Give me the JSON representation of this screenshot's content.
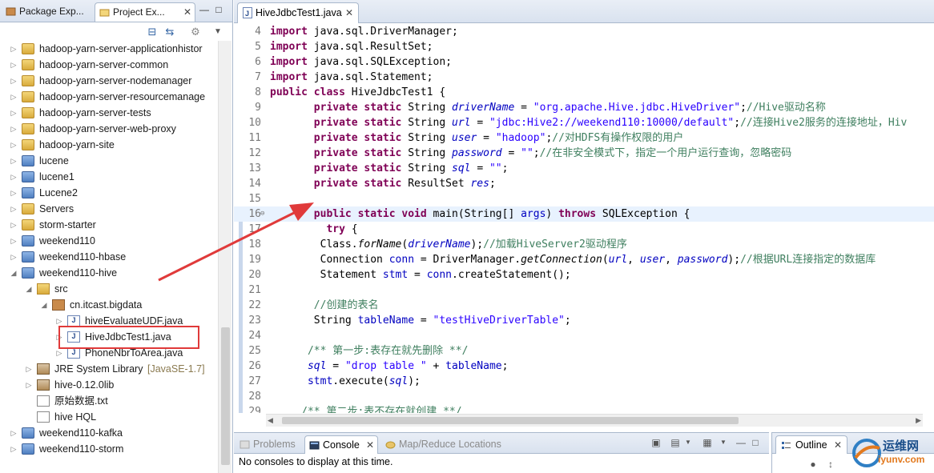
{
  "left_panel": {
    "tabs": [
      {
        "label": "Package Exp..."
      },
      {
        "label": "Project Ex..."
      }
    ],
    "tree": [
      {
        "label": "hadoop-yarn-server-applicationhistor",
        "icon": "folder-icon",
        "depth": 0,
        "expander": "collapsed"
      },
      {
        "label": "hadoop-yarn-server-common",
        "icon": "folder-icon",
        "depth": 0,
        "expander": "collapsed"
      },
      {
        "label": "hadoop-yarn-server-nodemanager",
        "icon": "folder-icon",
        "depth": 0,
        "expander": "collapsed"
      },
      {
        "label": "hadoop-yarn-server-resourcemanage",
        "icon": "folder-icon",
        "depth": 0,
        "expander": "collapsed"
      },
      {
        "label": "hadoop-yarn-server-tests",
        "icon": "folder-icon",
        "depth": 0,
        "expander": "collapsed"
      },
      {
        "label": "hadoop-yarn-server-web-proxy",
        "icon": "folder-icon",
        "depth": 0,
        "expander": "collapsed"
      },
      {
        "label": "hadoop-yarn-site",
        "icon": "folder-icon",
        "depth": 0,
        "expander": "collapsed"
      },
      {
        "label": "lucene",
        "icon": "project-icon",
        "depth": 0,
        "expander": "collapsed"
      },
      {
        "label": "lucene1",
        "icon": "project-icon",
        "depth": 0,
        "expander": "collapsed"
      },
      {
        "label": "Lucene2",
        "icon": "project-icon",
        "depth": 0,
        "expander": "collapsed"
      },
      {
        "label": "Servers",
        "icon": "folder-icon",
        "depth": 0,
        "expander": "collapsed"
      },
      {
        "label": "storm-starter",
        "icon": "folder-icon",
        "depth": 0,
        "expander": "collapsed"
      },
      {
        "label": "weekend110",
        "icon": "project-icon",
        "depth": 0,
        "expander": "collapsed"
      },
      {
        "label": "weekend110-hbase",
        "icon": "project-icon",
        "depth": 0,
        "expander": "collapsed"
      },
      {
        "label": "weekend110-hive",
        "icon": "project-icon",
        "depth": 0,
        "expander": "expanded"
      },
      {
        "label": "src",
        "icon": "source-folder-icon",
        "depth": 1,
        "expander": "expanded"
      },
      {
        "label": "cn.itcast.bigdata",
        "icon": "package-icon",
        "depth": 2,
        "expander": "expanded"
      },
      {
        "label": "hiveEvaluateUDF.java",
        "icon": "java-file-icon",
        "depth": 3,
        "expander": "collapsed"
      },
      {
        "label": "HiveJdbcTest1.java",
        "icon": "java-file-icon",
        "depth": 3,
        "expander": "collapsed"
      },
      {
        "label": "PhoneNbrToArea.java",
        "icon": "java-file-icon",
        "depth": 3,
        "expander": "collapsed"
      },
      {
        "label": "JRE System Library",
        "extra": "[JavaSE-1.7]",
        "icon": "library-icon",
        "depth": 1,
        "expander": "collapsed"
      },
      {
        "label": "hive-0.12.0lib",
        "icon": "library-icon",
        "depth": 1,
        "expander": "collapsed"
      },
      {
        "label": "原始数据.txt",
        "icon": "text-file-icon",
        "depth": 1,
        "expander": "none"
      },
      {
        "label": "hive HQL",
        "icon": "text-file-icon",
        "depth": 1,
        "expander": "none"
      },
      {
        "label": "weekend110-kafka",
        "icon": "project-icon",
        "depth": 0,
        "expander": "collapsed"
      },
      {
        "label": "weekend110-storm",
        "icon": "project-icon",
        "depth": 0,
        "expander": "collapsed"
      }
    ]
  },
  "editor": {
    "tab_label": "HiveJdbcTest1.java",
    "current_line": 16,
    "lines": [
      {
        "n": "4",
        "tokens": [
          [
            "kw",
            "import"
          ],
          [
            "t",
            " java.sql.DriverManager;"
          ]
        ]
      },
      {
        "n": "5",
        "tokens": [
          [
            "kw",
            "import"
          ],
          [
            "t",
            " java.sql.ResultSet;"
          ]
        ]
      },
      {
        "n": "6",
        "tokens": [
          [
            "kw",
            "import"
          ],
          [
            "t",
            " java.sql.SQLException;"
          ]
        ]
      },
      {
        "n": "7",
        "tokens": [
          [
            "kw",
            "import"
          ],
          [
            "t",
            " java.sql.Statement;"
          ]
        ]
      },
      {
        "n": "8",
        "tokens": [
          [
            "kw",
            "public"
          ],
          [
            "t",
            " "
          ],
          [
            "kw",
            "class"
          ],
          [
            "t",
            " HiveJdbcTest1 {"
          ]
        ]
      },
      {
        "n": "9",
        "tokens": [
          [
            "t",
            "       "
          ],
          [
            "kw",
            "private"
          ],
          [
            "t",
            " "
          ],
          [
            "kw",
            "static"
          ],
          [
            "t",
            " String "
          ],
          [
            "fld",
            "driverName"
          ],
          [
            "t",
            " = "
          ],
          [
            "str",
            "\"org.apache.Hive.jdbc.HiveDriver\""
          ],
          [
            "t",
            ";"
          ],
          [
            "cmt",
            "//Hive驱动名称"
          ]
        ]
      },
      {
        "n": "10",
        "tokens": [
          [
            "t",
            "       "
          ],
          [
            "kw",
            "private"
          ],
          [
            "t",
            " "
          ],
          [
            "kw",
            "static"
          ],
          [
            "t",
            " String "
          ],
          [
            "fld",
            "url"
          ],
          [
            "t",
            " = "
          ],
          [
            "str",
            "\"jdbc:Hive2://weekend110:10000/default\""
          ],
          [
            "t",
            ";"
          ],
          [
            "cmt",
            "//连接Hive2服务的连接地址，Hiv"
          ]
        ]
      },
      {
        "n": "11",
        "tokens": [
          [
            "t",
            "       "
          ],
          [
            "kw",
            "private"
          ],
          [
            "t",
            " "
          ],
          [
            "kw",
            "static"
          ],
          [
            "t",
            " String "
          ],
          [
            "fld",
            "user"
          ],
          [
            "t",
            " = "
          ],
          [
            "str",
            "\"hadoop\""
          ],
          [
            "t",
            ";"
          ],
          [
            "cmt",
            "//对HDFS有操作权限的用户"
          ]
        ]
      },
      {
        "n": "12",
        "tokens": [
          [
            "t",
            "       "
          ],
          [
            "kw",
            "private"
          ],
          [
            "t",
            " "
          ],
          [
            "kw",
            "static"
          ],
          [
            "t",
            " String "
          ],
          [
            "fld",
            "password"
          ],
          [
            "t",
            " = "
          ],
          [
            "str",
            "\"\""
          ],
          [
            "t",
            ";"
          ],
          [
            "cmt",
            "//在非安全模式下，指定一个用户运行查询，忽略密码"
          ]
        ]
      },
      {
        "n": "13",
        "tokens": [
          [
            "t",
            "       "
          ],
          [
            "kw",
            "private"
          ],
          [
            "t",
            " "
          ],
          [
            "kw",
            "static"
          ],
          [
            "t",
            " String "
          ],
          [
            "fld",
            "sql"
          ],
          [
            "t",
            " = "
          ],
          [
            "str",
            "\"\""
          ],
          [
            "t",
            ";"
          ]
        ]
      },
      {
        "n": "14",
        "tokens": [
          [
            "t",
            "       "
          ],
          [
            "kw",
            "private"
          ],
          [
            "t",
            " "
          ],
          [
            "kw",
            "static"
          ],
          [
            "t",
            " ResultSet "
          ],
          [
            "fld",
            "res"
          ],
          [
            "t",
            ";"
          ]
        ]
      },
      {
        "n": "15",
        "tokens": []
      },
      {
        "n": "16",
        "tokens": [
          [
            "t",
            "       "
          ],
          [
            "kw",
            "public"
          ],
          [
            "t",
            " "
          ],
          [
            "kw",
            "static"
          ],
          [
            "t",
            " "
          ],
          [
            "kw",
            "void"
          ],
          [
            "t",
            " main(String[] "
          ],
          [
            "ivar",
            "args"
          ],
          [
            "t",
            ") "
          ],
          [
            "kw",
            "throws"
          ],
          [
            "t",
            " SQLException {"
          ]
        ]
      },
      {
        "n": "17",
        "tokens": [
          [
            "t",
            "         "
          ],
          [
            "kw",
            "try"
          ],
          [
            "t",
            " {"
          ]
        ]
      },
      {
        "n": "18",
        "tokens": [
          [
            "t",
            "        Class."
          ],
          [
            "mth",
            "forName"
          ],
          [
            "t",
            "("
          ],
          [
            "fld",
            "driverName"
          ],
          [
            "t",
            ");"
          ],
          [
            "cmt",
            "//加载HiveServer2驱动程序"
          ]
        ]
      },
      {
        "n": "19",
        "tokens": [
          [
            "t",
            "        Connection "
          ],
          [
            "ivar",
            "conn"
          ],
          [
            "t",
            " = DriverManager."
          ],
          [
            "mth",
            "getConnection"
          ],
          [
            "t",
            "("
          ],
          [
            "fld",
            "url"
          ],
          [
            "t",
            ", "
          ],
          [
            "fld",
            "user"
          ],
          [
            "t",
            ", "
          ],
          [
            "fld",
            "password"
          ],
          [
            "t",
            ");"
          ],
          [
            "cmt",
            "//根据URL连接指定的数据库"
          ]
        ]
      },
      {
        "n": "20",
        "tokens": [
          [
            "t",
            "        Statement "
          ],
          [
            "ivar",
            "stmt"
          ],
          [
            "t",
            " = "
          ],
          [
            "ivar",
            "conn"
          ],
          [
            "t",
            ".createStatement();"
          ]
        ]
      },
      {
        "n": "21",
        "tokens": []
      },
      {
        "n": "22",
        "tokens": [
          [
            "t",
            "       "
          ],
          [
            "cmt",
            "//创建的表名"
          ]
        ]
      },
      {
        "n": "23",
        "tokens": [
          [
            "t",
            "       String "
          ],
          [
            "ivar",
            "tableName"
          ],
          [
            "t",
            " = "
          ],
          [
            "str",
            "\"testHiveDriverTable\""
          ],
          [
            "t",
            ";"
          ]
        ]
      },
      {
        "n": "24",
        "tokens": []
      },
      {
        "n": "25",
        "tokens": [
          [
            "t",
            "      "
          ],
          [
            "cmt",
            "/** 第一步:表存在就先删除 **/"
          ]
        ]
      },
      {
        "n": "26",
        "tokens": [
          [
            "t",
            "      "
          ],
          [
            "fld",
            "sql"
          ],
          [
            "t",
            " = "
          ],
          [
            "str",
            "\"drop table \""
          ],
          [
            "t",
            " + "
          ],
          [
            "ivar",
            "tableName"
          ],
          [
            "t",
            ";"
          ]
        ]
      },
      {
        "n": "27",
        "tokens": [
          [
            "t",
            "      "
          ],
          [
            "ivar",
            "stmt"
          ],
          [
            "t",
            ".execute("
          ],
          [
            "fld",
            "sql"
          ],
          [
            "t",
            ");"
          ]
        ]
      },
      {
        "n": "28",
        "tokens": []
      },
      {
        "n": "29",
        "tokens": [
          [
            "t",
            "     "
          ],
          [
            "cmt",
            "/** 第二步:表不存在就创建 **/"
          ]
        ]
      }
    ]
  },
  "console": {
    "tabs": [
      {
        "label": "Problems"
      },
      {
        "label": "Console"
      },
      {
        "label": "Map/Reduce Locations"
      }
    ],
    "message": "No consoles to display at this time."
  },
  "outline": {
    "tab_label": "Outline"
  },
  "watermark": {
    "line1": "运维网",
    "line2": "iyunv.com"
  },
  "colors": {
    "keyword": "#7f0055",
    "string": "#2a00ff",
    "comment": "#3f7f5f",
    "field": "#0000c0",
    "highlight_box": "#e03a3a",
    "arrow": "#e03a3a"
  }
}
